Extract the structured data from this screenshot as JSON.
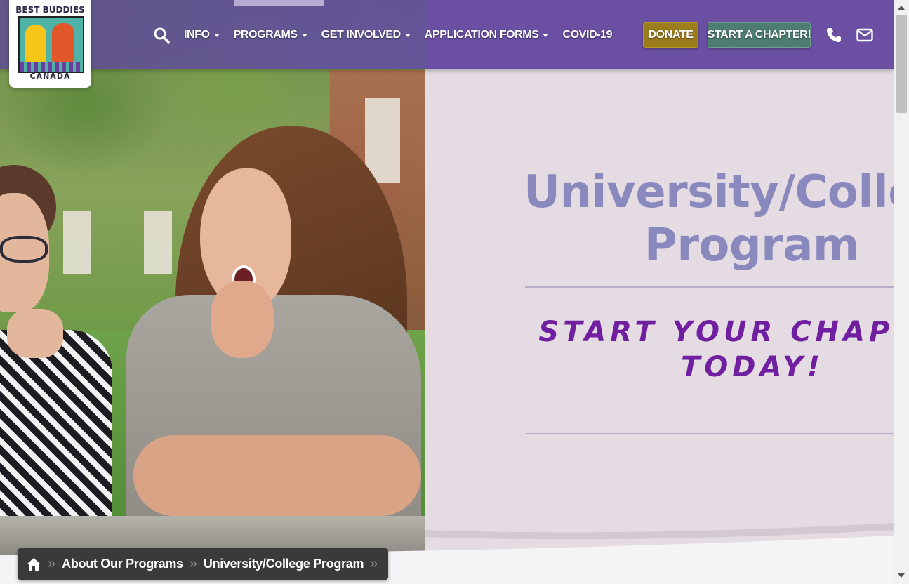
{
  "logo": {
    "top_text": "BEST BUDDIES",
    "bottom_text": "CANADA"
  },
  "nav": {
    "items": [
      {
        "label": "INFO",
        "has_dropdown": true
      },
      {
        "label": "PROGRAMS",
        "has_dropdown": true
      },
      {
        "label": "GET INVOLVED",
        "has_dropdown": true
      },
      {
        "label": "APPLICATION FORMS",
        "has_dropdown": true
      },
      {
        "label": "COVID-19",
        "has_dropdown": false
      }
    ],
    "donate_label": "DONATE",
    "start_chapter_label": "START A CHAPTER!",
    "icons": [
      "search-icon",
      "phone-icon",
      "mail-icon"
    ]
  },
  "hero": {
    "title_line1": "University/College",
    "title_line2": "Program",
    "subtitle_line1": "START YOUR CHAPTER",
    "subtitle_line2": "TODAY!"
  },
  "breadcrumb": {
    "items": [
      {
        "label": "About Our Programs"
      },
      {
        "label": "University/College Program"
      }
    ],
    "home_icon": "home-icon"
  },
  "colors": {
    "header": "#6a4fa3",
    "donate": "#9b7d1c",
    "start_chapter": "#4d7d72",
    "hero_panel": "#e4dce2",
    "title": "#8a89be",
    "subtitle": "#6f1fa0",
    "breadcrumb_bg": "#3a3a3a"
  }
}
